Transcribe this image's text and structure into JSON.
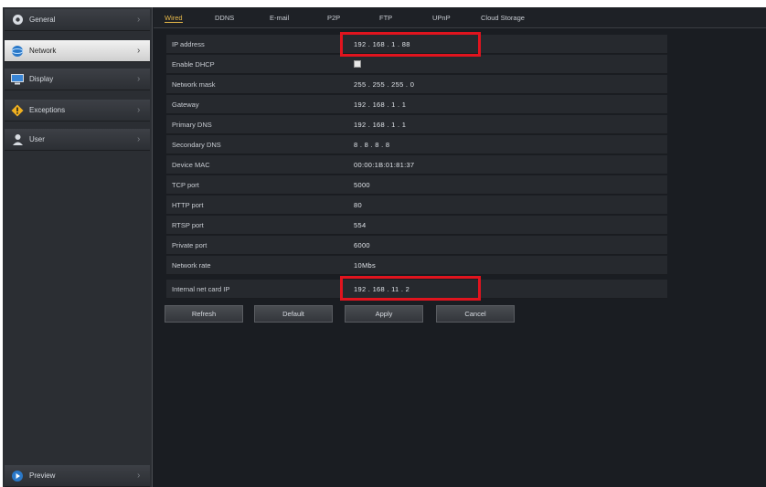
{
  "sidebar": {
    "items": [
      {
        "label": "General",
        "icon": "gear-icon"
      },
      {
        "label": "Network",
        "icon": "globe-icon"
      },
      {
        "label": "Display",
        "icon": "monitor-icon"
      },
      {
        "label": "Exceptions",
        "icon": "warning-icon"
      },
      {
        "label": "User",
        "icon": "user-icon"
      }
    ],
    "active_index": 1,
    "bottom": {
      "label": "Preview",
      "icon": "play-icon"
    }
  },
  "tabs": [
    "Wired",
    "DDNS",
    "E-mail",
    "P2P",
    "FTP",
    "UPnP",
    "Cloud Storage"
  ],
  "active_tab": 0,
  "fields": {
    "ip_address": {
      "label": "IP address",
      "value": "192 . 168 . 1 . 88"
    },
    "dhcp": {
      "label": "Enable DHCP"
    },
    "netmask": {
      "label": "Network mask",
      "value": "255 . 255 . 255 . 0"
    },
    "gateway": {
      "label": "Gateway",
      "value": "192 . 168 . 1 . 1"
    },
    "dns1": {
      "label": "Primary DNS",
      "value": "192 . 168 . 1 . 1"
    },
    "dns2": {
      "label": "Secondary DNS",
      "value": "8 . 8 . 8 . 8"
    },
    "mac": {
      "label": "Device MAC",
      "value": "00:00:1B:01:81:37"
    },
    "tcp_port": {
      "label": "TCP port",
      "value": "5000"
    },
    "http_port": {
      "label": "HTTP port",
      "value": "80"
    },
    "rtsp_port": {
      "label": "RTSP port",
      "value": "554"
    },
    "private_port": {
      "label": "Private port",
      "value": "6000"
    },
    "net_rate": {
      "label": "Network rate",
      "value": "10Mbs"
    },
    "internal_ip": {
      "label": "Internal net card IP",
      "value": "192 . 168 . 11 . 2"
    }
  },
  "buttons": {
    "refresh": "Refresh",
    "default": "Default",
    "apply": "Apply",
    "cancel": "Cancel"
  },
  "colors": {
    "highlight": "#e0141e",
    "active_tab": "#e6b84a"
  }
}
